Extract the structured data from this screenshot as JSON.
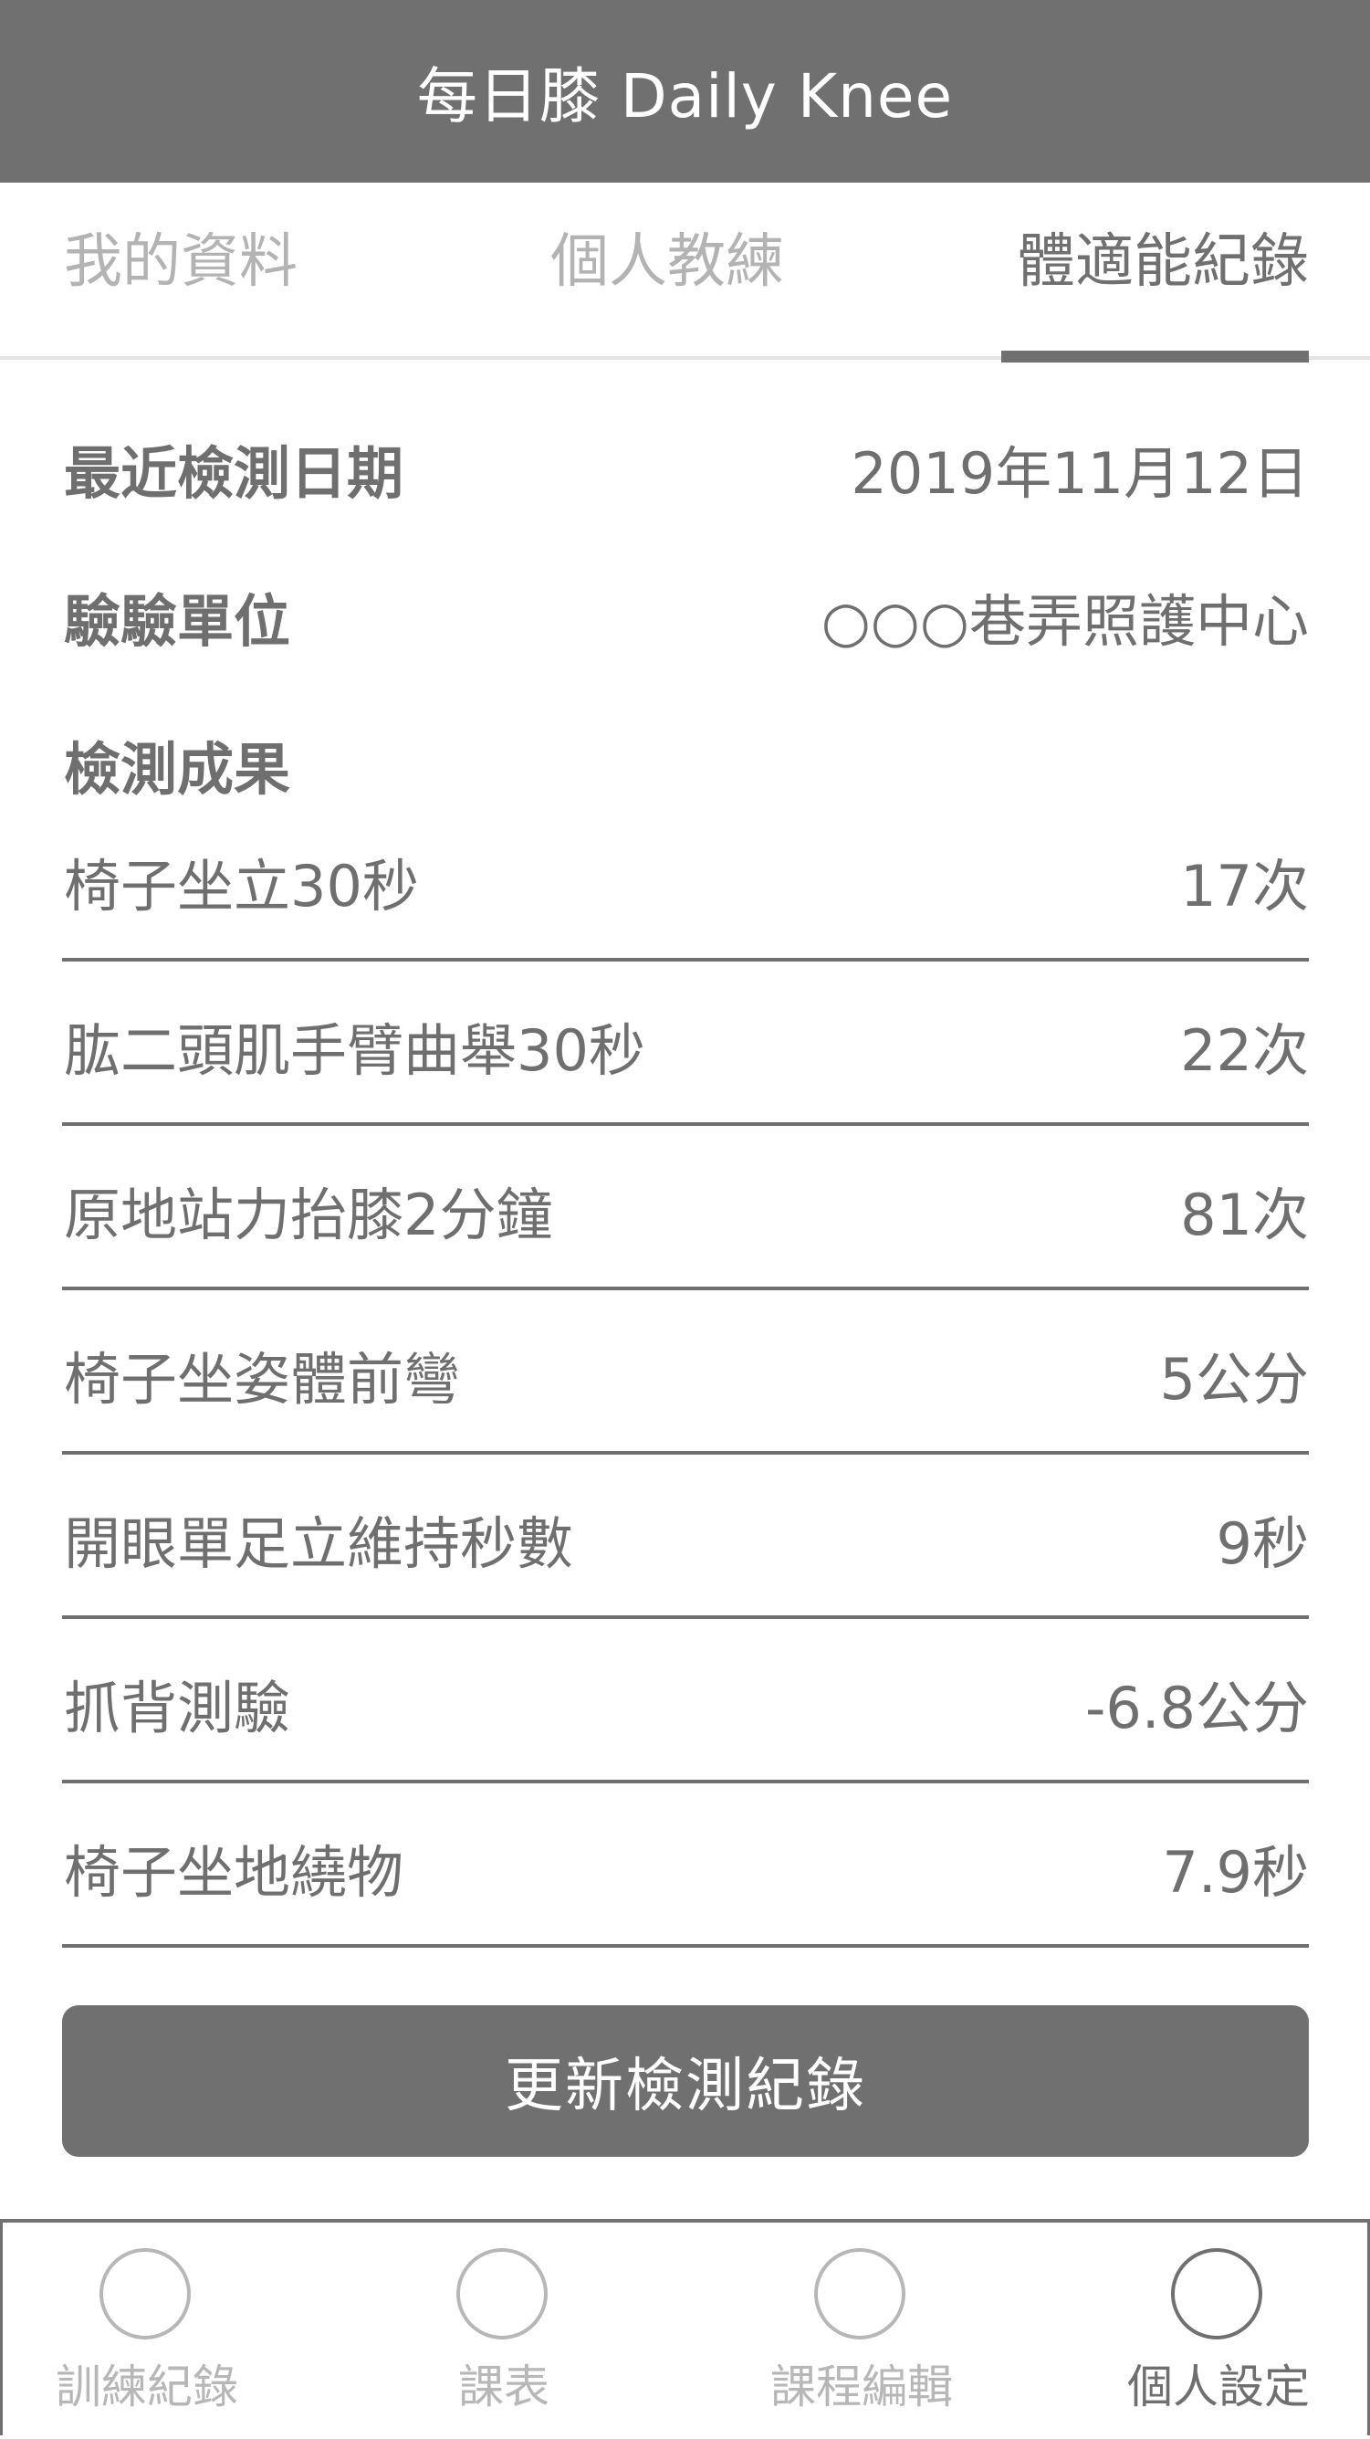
{
  "header": {
    "title": "每日膝 Daily Knee"
  },
  "tabs": [
    {
      "label": "我的資料",
      "active": false
    },
    {
      "label": "個人教練",
      "active": false
    },
    {
      "label": "體適能紀錄",
      "active": true
    }
  ],
  "info": {
    "date_label": "最近檢測日期",
    "date_value": "2019年11月12日",
    "unit_label": "驗驗單位",
    "unit_value": "○○○巷弄照護中心",
    "results_label": "檢測成果"
  },
  "results": [
    {
      "label": "椅子坐立30秒",
      "value": "17次"
    },
    {
      "label": "肱二頭肌手臂曲舉30秒",
      "value": "22次"
    },
    {
      "label": "原地站力抬膝2分鐘",
      "value": "81次"
    },
    {
      "label": "椅子坐姿體前彎",
      "value": "5公分"
    },
    {
      "label": "開眼單足立維持秒數",
      "value": "9秒"
    },
    {
      "label": "抓背測驗",
      "value": "-6.8公分"
    },
    {
      "label": "椅子坐地繞物",
      "value": "7.9秒"
    }
  ],
  "update_button": {
    "label": "更新檢測紀錄"
  },
  "bottom_nav": [
    {
      "label": "訓練紀錄",
      "icon": "circle-icon",
      "active": false
    },
    {
      "label": "課表",
      "icon": "circle-icon",
      "active": false
    },
    {
      "label": "課程編輯",
      "icon": "circle-icon",
      "active": false
    },
    {
      "label": "個人設定",
      "icon": "circle-icon",
      "active": true
    }
  ],
  "colors": {
    "header_bg": "#717071",
    "text_primary": "#707070",
    "text_inactive": "#b3b3b3",
    "divider": "#e3e3e3"
  }
}
